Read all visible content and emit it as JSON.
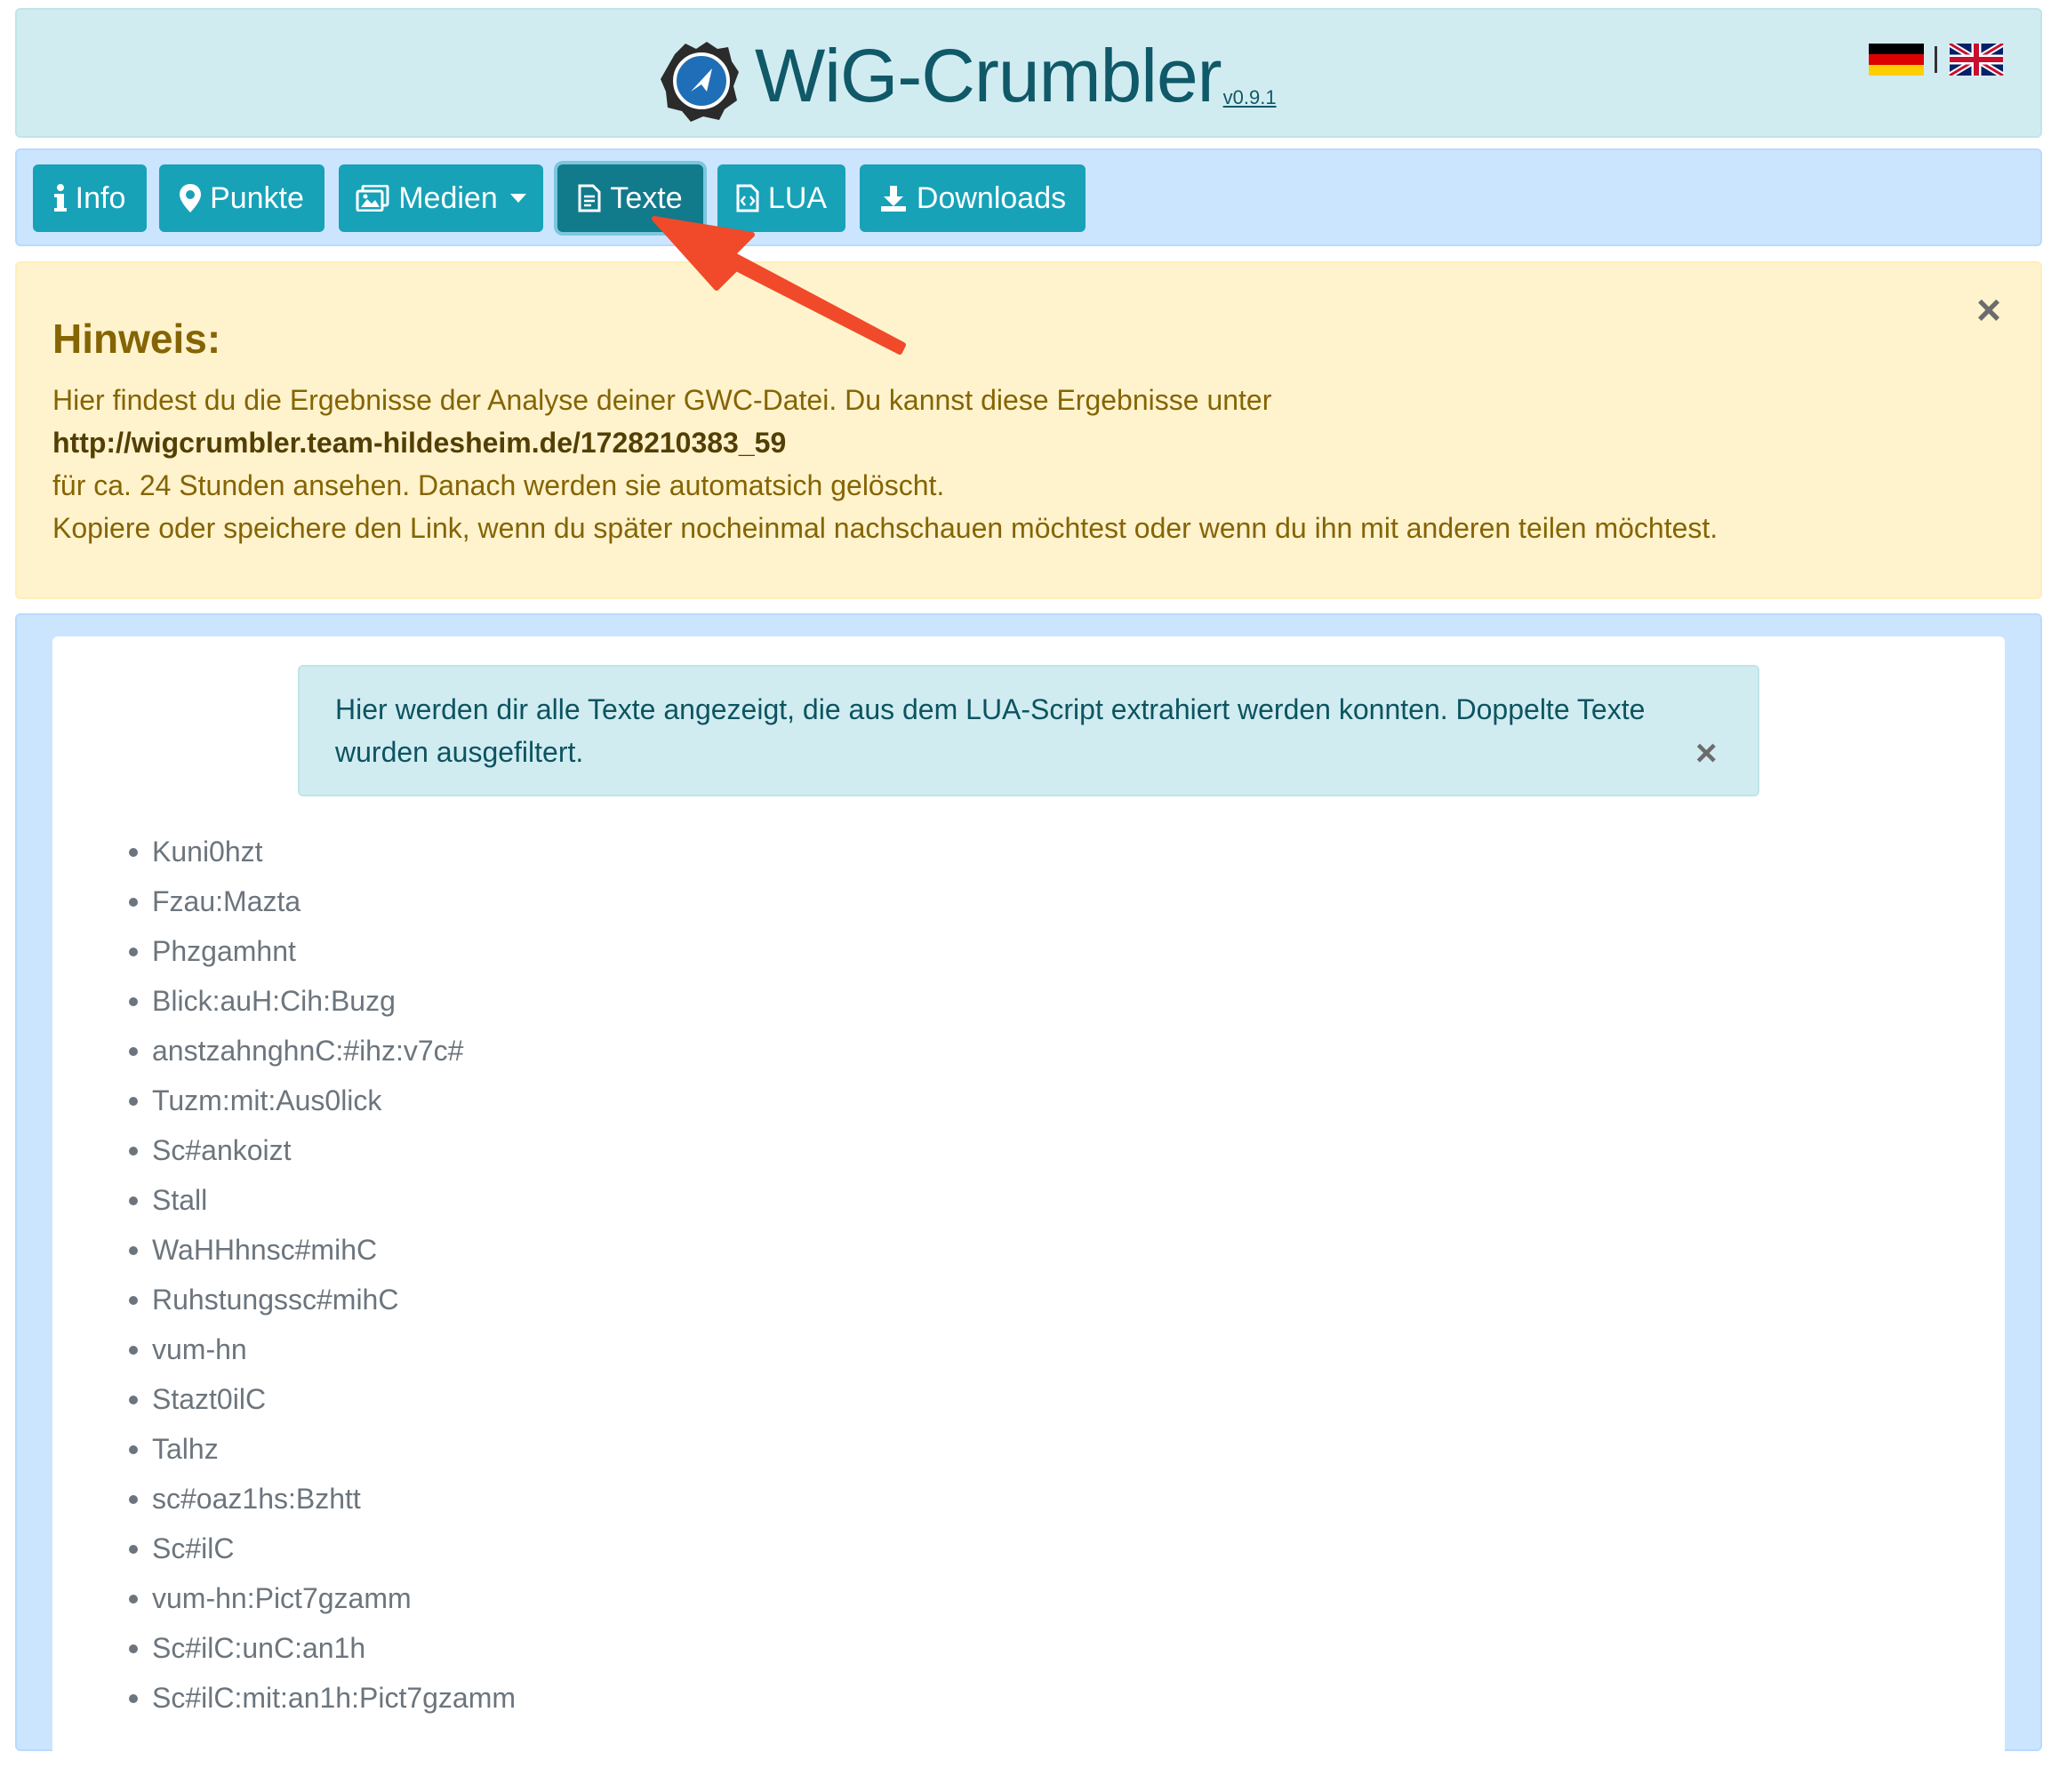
{
  "header": {
    "title": "WiG-Crumbler",
    "version": "v0.9.1",
    "languages": [
      "de",
      "en"
    ]
  },
  "nav": {
    "info": "Info",
    "punkte": "Punkte",
    "medien": "Medien",
    "texte": "Texte",
    "lua": "LUA",
    "downloads": "Downloads",
    "active": "Texte"
  },
  "notice": {
    "heading": "Hinweis:",
    "line1": "Hier findest du die Ergebnisse der Analyse deiner GWC-Datei. Du kannst diese Ergebnisse unter",
    "url": "http://wigcrumbler.team-hildesheim.de/1728210383_59",
    "line3": "für ca. 24 Stunden ansehen. Danach werden sie automatsich gelöscht.",
    "line4": "Kopiere oder speichere den Link, wenn du später nocheinmal nachschauen möchtest oder wenn du ihn mit anderen teilen möchtest.",
    "close": "×"
  },
  "info_box": {
    "text": "Hier werden dir alle Texte angezeigt, die aus dem LUA-Script extrahiert werden konnten. Doppelte Texte wurden ausgefiltert.",
    "close": "×"
  },
  "texts": [
    "Kuni0hzt",
    "Fzau:Mazta",
    "Phzgamhnt",
    "Blick:auH:Cih:Buzg",
    "anstzahnghnC:#ihz:v7c#",
    "Tuzm:mit:Aus0lick",
    "Sc#ankoizt",
    "Stall",
    "WaHHhnsc#mihC",
    "Ruhstungssc#mihC",
    "vum-hn",
    "Stazt0ilC",
    "Talhz",
    "sc#oaz1hs:Bzhtt",
    "Sc#ilC",
    "vum-hn:Pict7gzamm",
    "Sc#ilC:unC:an1h",
    "Sc#ilC:mit:an1h:Pict7gzamm"
  ],
  "colors": {
    "nav_button": "#17a2b8",
    "nav_active": "#117a8b",
    "annotation_arrow": "#f04a2a"
  }
}
